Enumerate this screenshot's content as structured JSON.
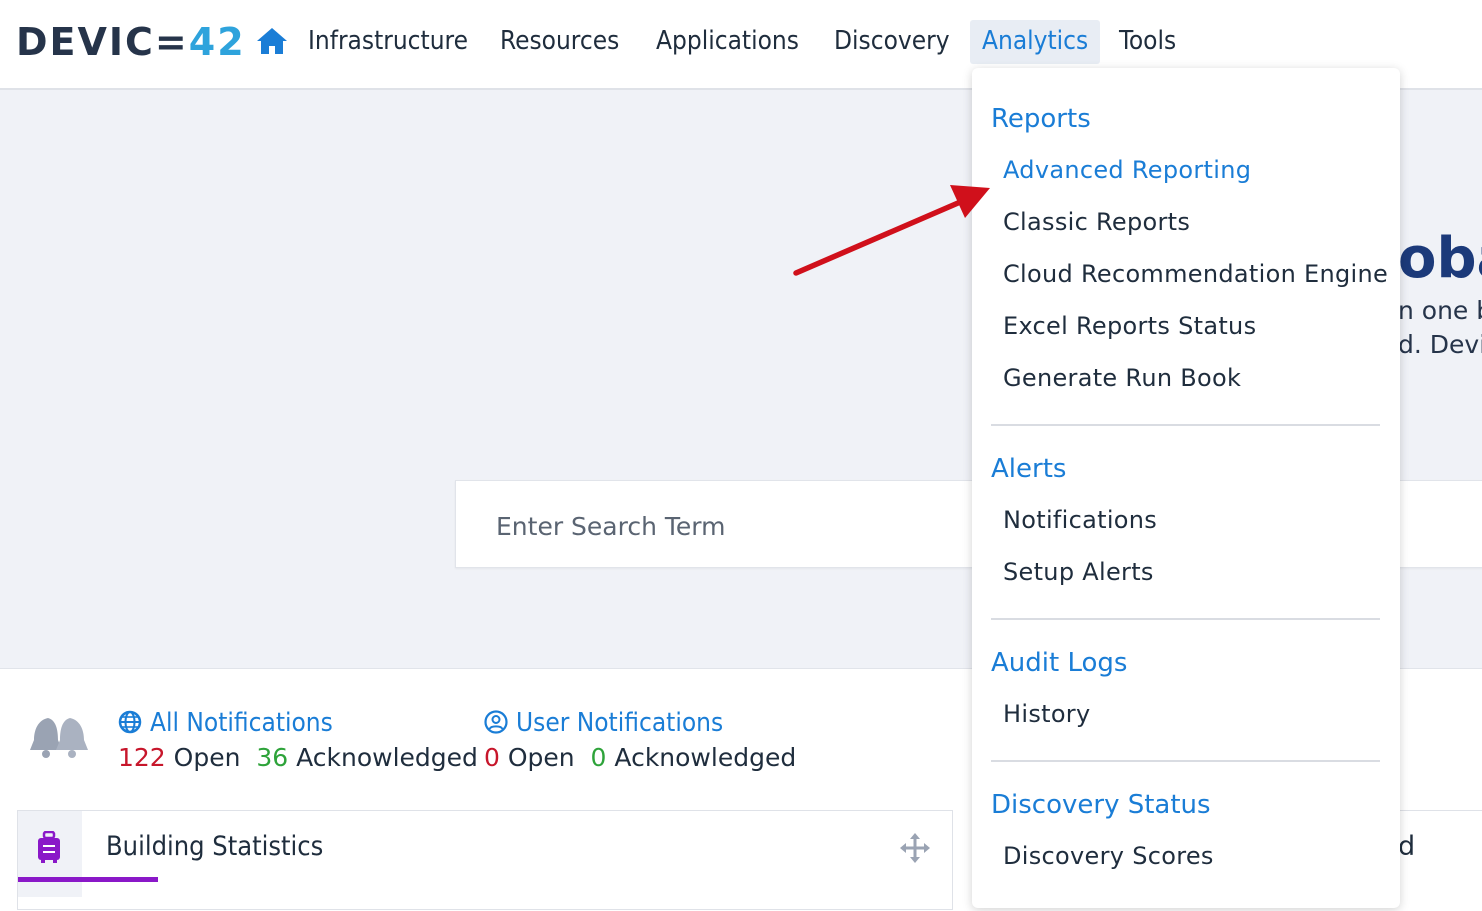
{
  "brand": {
    "logo_part1": "DEVIC=",
    "logo_part2": "42",
    "logo_dark": "#26344a",
    "logo_light": "#2ea3dc"
  },
  "nav": {
    "home_icon": "home-icon",
    "items": [
      "Infrastructure",
      "Resources",
      "Applications",
      "Discovery",
      "Analytics",
      "Tools"
    ],
    "active": "Analytics"
  },
  "hero": {
    "title_fragment": "oba",
    "line1_fragment": "n one b",
    "line2_fragment": "d. Devic"
  },
  "search": {
    "placeholder": "Enter Search Term"
  },
  "notifications": {
    "all": {
      "title": "All Notifications",
      "open_count": "122",
      "open_label": "Open",
      "ack_count": "36",
      "ack_label": "Acknowledged"
    },
    "user": {
      "title": "User Notifications",
      "open_count": "0",
      "open_label": "Open",
      "ack_count": "0",
      "ack_label": "Acknowledged"
    }
  },
  "widgets": {
    "building_statistics": {
      "title": "Building Statistics"
    },
    "right_card_fragment": "d"
  },
  "analytics_menu": {
    "sections": [
      {
        "header": "Reports",
        "items": [
          "Advanced Reporting",
          "Classic Reports",
          "Cloud Recommendation Engine",
          "Excel Reports Status",
          "Generate Run Book"
        ]
      },
      {
        "header": "Alerts",
        "items": [
          "Notifications",
          "Setup Alerts"
        ]
      },
      {
        "header": "Audit Logs",
        "items": [
          "History"
        ]
      },
      {
        "header": "Discovery Status",
        "items": [
          "Discovery Scores"
        ]
      }
    ],
    "highlighted_item": "Advanced Reporting"
  },
  "colors": {
    "accent": "#1a7dd6",
    "annotation_arrow": "#d0101b",
    "purple": "#8a18c8",
    "red": "#c7162b",
    "green": "#2ea33a"
  }
}
